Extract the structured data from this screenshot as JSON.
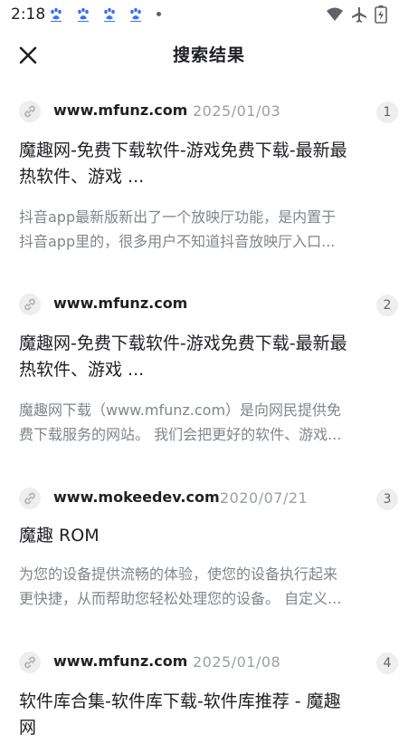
{
  "status_bar": {
    "time": "2:18",
    "notification_icons": [
      "baidu-paw-icon",
      "baidu-paw-icon",
      "baidu-paw-icon",
      "baidu-paw-icon"
    ],
    "system_icons": [
      "wifi-icon",
      "airplane-icon",
      "battery-charging-icon"
    ]
  },
  "header": {
    "close_icon": "close-icon",
    "title": "搜索结果"
  },
  "colors": {
    "paw_blue": "#3b6ff5",
    "text_primary": "#202124",
    "text_secondary": "#80868b",
    "date_gray": "#9aa0a6",
    "badge_bg": "#eeeeee"
  },
  "results": [
    {
      "domain": "www.mfunz.com",
      "date": "2025/01/03",
      "index": "1",
      "title_lines": [
        "魔趣网-免费下载软件-游戏免费下载-最新最",
        "热软件、游戏 ..."
      ],
      "snippet_lines": [
        "抖音app最新版新出了一个放映厅功能，是内置于",
        "抖音app里的，很多用户不知道抖音放映厅入口..."
      ]
    },
    {
      "domain": "www.mfunz.com",
      "date": "",
      "index": "2",
      "title_lines": [
        "魔趣网-免费下载软件-游戏免费下载-最新最",
        "热软件、游戏 ..."
      ],
      "snippet_lines": [
        "魔趣网下载（www.mfunz.com）是向网民提供免",
        "费下载服务的网站。 我们会把更好的软件、游戏..."
      ]
    },
    {
      "domain": "www.mokeedev.com",
      "date": "2020/07/21",
      "index": "3",
      "title_lines": [
        "魔趣 ROM"
      ],
      "snippet_lines": [
        "为您的设备提供流畅的体验，使您的设备执行起来",
        "更快捷，从而帮助您轻松处理您的设备。 自定义..."
      ]
    },
    {
      "domain": "www.mfunz.com",
      "date": "2025/01/08",
      "index": "4",
      "title_lines": [
        "软件库合集-软件库下载-软件库推荐 - 魔趣",
        "网"
      ],
      "snippet_lines": []
    }
  ]
}
